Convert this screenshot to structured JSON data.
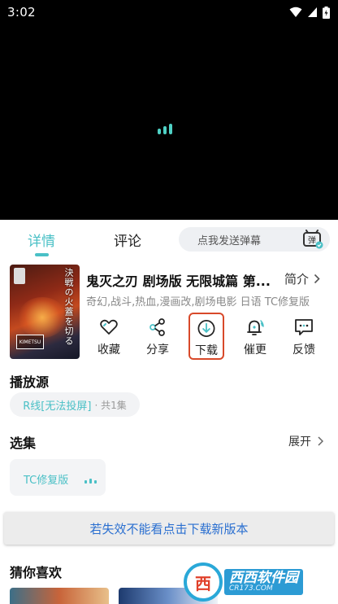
{
  "status_bar": {
    "time": "3:02"
  },
  "player": {
    "state": "loading"
  },
  "tabs": {
    "items": [
      {
        "label": "详情",
        "active": true
      },
      {
        "label": "评论",
        "active": false
      }
    ]
  },
  "danmu": {
    "placeholder": "点我发送弹幕",
    "icon_label": "弹"
  },
  "video": {
    "title": "鬼灭之刃 剧场版 无限城篇 第...",
    "intro_label": "简介",
    "tags": "奇幻,战斗,热血,漫画改,剧场电影 日语 TC修复版",
    "poster_title": "決戦の火蓋を切る"
  },
  "actions": [
    {
      "label": "收藏",
      "icon": "heart-icon"
    },
    {
      "label": "分享",
      "icon": "share-icon"
    },
    {
      "label": "下载",
      "icon": "download-icon",
      "highlighted": true
    },
    {
      "label": "催更",
      "icon": "bell-icon"
    },
    {
      "label": "反馈",
      "icon": "feedback-icon"
    }
  ],
  "source": {
    "title": "播放源",
    "line": "R线[无法投屏]",
    "count": "· 共1集"
  },
  "episodes": {
    "title": "选集",
    "expand_label": "展开",
    "current": "TC修复版"
  },
  "banner": {
    "text": "若失效不能看点击下载新版本"
  },
  "recommend": {
    "title": "猜你喜欢"
  },
  "watermark": {
    "circle_glyph": "西",
    "name": "西西软件园",
    "url": "CR173.COM"
  },
  "colors": {
    "accent": "#4ac0c6",
    "highlight": "#d8492a",
    "banner_text": "#2a6fd0"
  }
}
